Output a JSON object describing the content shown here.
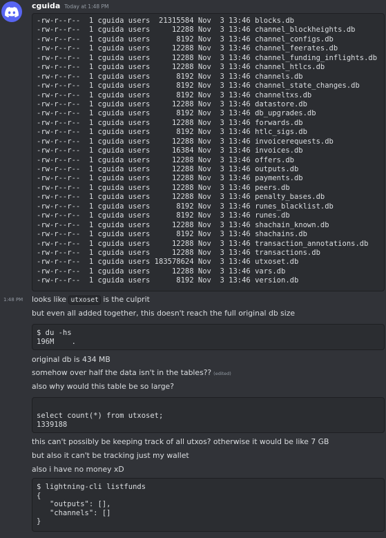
{
  "header": {
    "username": "cguida",
    "timestamp": "Today at 1:48 PM"
  },
  "ls_listing": [
    "-rw-r--r--  1 cguida users  21315584 Nov  3 13:46 blocks.db",
    "-rw-r--r--  1 cguida users     12288 Nov  3 13:46 channel_blockheights.db",
    "-rw-r--r--  1 cguida users      8192 Nov  3 13:46 channel_configs.db",
    "-rw-r--r--  1 cguida users     12288 Nov  3 13:46 channel_feerates.db",
    "-rw-r--r--  1 cguida users     12288 Nov  3 13:46 channel_funding_inflights.db",
    "-rw-r--r--  1 cguida users     12288 Nov  3 13:46 channel_htlcs.db",
    "-rw-r--r--  1 cguida users      8192 Nov  3 13:46 channels.db",
    "-rw-r--r--  1 cguida users      8192 Nov  3 13:46 channel_state_changes.db",
    "-rw-r--r--  1 cguida users      8192 Nov  3 13:46 channeltxs.db",
    "-rw-r--r--  1 cguida users     12288 Nov  3 13:46 datastore.db",
    "-rw-r--r--  1 cguida users      8192 Nov  3 13:46 db_upgrades.db",
    "-rw-r--r--  1 cguida users     12288 Nov  3 13:46 forwards.db",
    "-rw-r--r--  1 cguida users      8192 Nov  3 13:46 htlc_sigs.db",
    "-rw-r--r--  1 cguida users     12288 Nov  3 13:46 invoicerequests.db",
    "-rw-r--r--  1 cguida users     16384 Nov  3 13:46 invoices.db",
    "-rw-r--r--  1 cguida users     12288 Nov  3 13:46 offers.db",
    "-rw-r--r--  1 cguida users     12288 Nov  3 13:46 outputs.db",
    "-rw-r--r--  1 cguida users     12288 Nov  3 13:46 payments.db",
    "-rw-r--r--  1 cguida users     12288 Nov  3 13:46 peers.db",
    "-rw-r--r--  1 cguida users     12288 Nov  3 13:46 penalty_bases.db",
    "-rw-r--r--  1 cguida users      8192 Nov  3 13:46 runes_blacklist.db",
    "-rw-r--r--  1 cguida users      8192 Nov  3 13:46 runes.db",
    "-rw-r--r--  1 cguida users     12288 Nov  3 13:46 shachain_known.db",
    "-rw-r--r--  1 cguida users      8192 Nov  3 13:46 shachains.db",
    "-rw-r--r--  1 cguida users     12288 Nov  3 13:46 transaction_annotations.db",
    "-rw-r--r--  1 cguida users     12288 Nov  3 13:46 transactions.db",
    "-rw-r--r--  1 cguida users 183578624 Nov  3 13:46 utxoset.db",
    "-rw-r--r--  1 cguida users     12288 Nov  3 13:46 vars.db",
    "-rw-r--r--  1 cguida users      8192 Nov  3 13:46 version.db"
  ],
  "side_time": "1:48 PM",
  "msg1": {
    "before": "looks like ",
    "code": "utxoset",
    "after": " is the culprit"
  },
  "msg2": "but even all added together, this doesn't reach the full original db size",
  "du_block": [
    "$ du -hs",
    "196M    ."
  ],
  "msg3": "original db is 434 MB",
  "msg4": {
    "text": "somehow over half the data isn't in the tables??",
    "edited": "(edited)"
  },
  "msg5": "also why would this table be so large?",
  "sql_block": [
    "select count(*) from utxoset;",
    "1339188"
  ],
  "msg6": "this can't possibly be keeping track of all utxos? otherwise it would be like 7 GB",
  "msg7": "but also it can't be tracking just my wallet",
  "msg8": "also i have no money xD",
  "listfunds_block": [
    "$ lightning-cli listfunds",
    "{",
    "   \"outputs\": [],",
    "   \"channels\": []",
    "}"
  ],
  "icons": {
    "avatar": "discord-logo-icon"
  },
  "colors": {
    "background": "#313338",
    "code_bg": "#2b2d31",
    "avatar": "#5865f2",
    "muted": "#949ba4"
  }
}
